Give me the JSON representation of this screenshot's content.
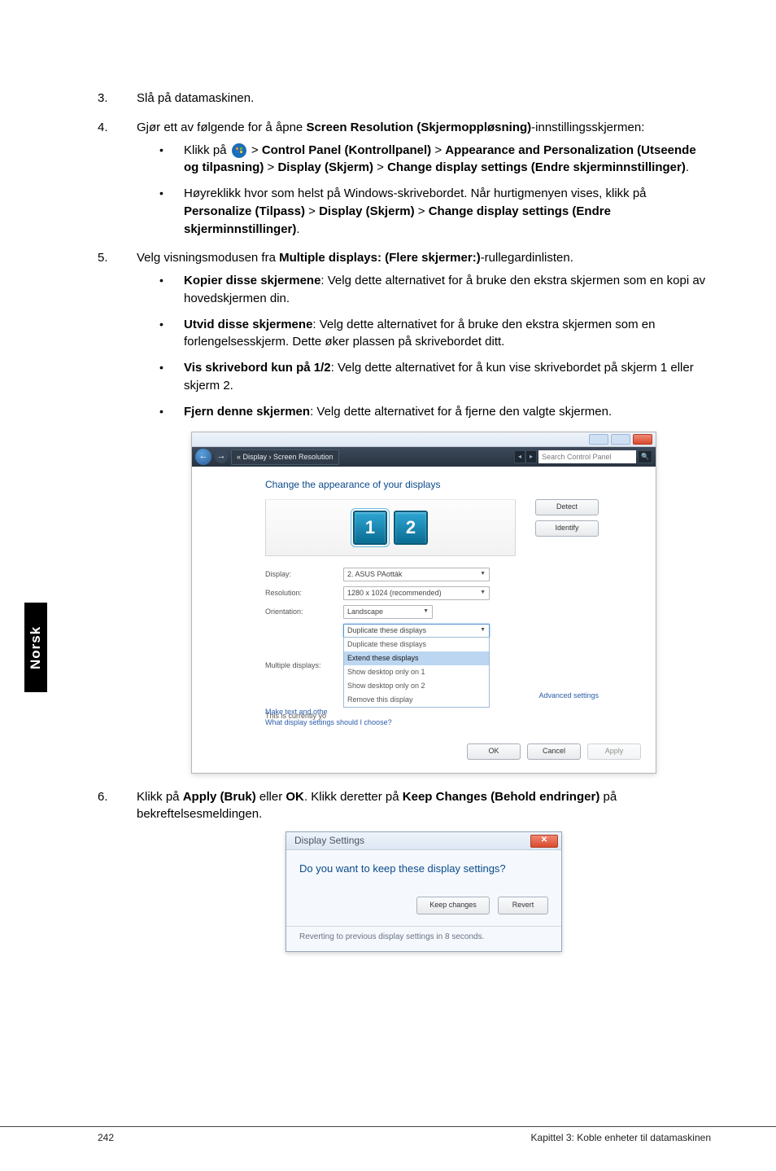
{
  "steps": {
    "s3": "Slå på datamaskinen.",
    "s4_lead": "Gjør ett av følgende for å åpne ",
    "s4_bold": "Screen Resolution (Skjermoppløsning)",
    "s4_tail": "-innstillingsskjermen:",
    "s4a_pre": "Klikk på ",
    "s4a_1": "Control Panel (Kontrollpanel)",
    "s4a_2": "Appearance and Personalization (Utseende og tilpasning)",
    "s4a_3": "Display (Skjerm)",
    "s4a_4": "Change display settings (Endre skjerminnstillinger)",
    "s4b_a": "Høyreklikk hvor som helst på Windows-skrivebordet. Når hurtigmenyen vises, klikk på ",
    "s4b_1": "Personalize (Tilpass)",
    "s4b_2": "Display (Skjerm)",
    "s4b_3": "Change display settings (Endre skjerminnstillinger)",
    "s5_lead": "Velg visningsmodusen fra ",
    "s5_bold": "Multiple displays: (Flere skjermer:)",
    "s5_tail": "-rullegardinlisten.",
    "s5a_b": "Kopier disse skjermene",
    "s5a_t": ": Velg dette alternativet for å bruke den ekstra skjermen som en kopi av hovedskjermen din.",
    "s5b_b": "Utvid disse skjermene",
    "s5b_t": ": Velg dette alternativet for å bruke den ekstra skjermen som en forlengelsesskjerm. Dette øker plassen på skrivebordet ditt.",
    "s5c_b": "Vis skrivebord kun på 1/2",
    "s5c_t": ": Velg dette alternativet for å kun vise skrivebordet på skjerm 1 eller skjerm 2.",
    "s5d_b": "Fjern denne skjermen",
    "s5d_t": ": Velg dette alternativet for å fjerne den valgte skjermen.",
    "s6_a": "Klikk på ",
    "s6_b1": "Apply (Bruk)",
    "s6_m": " eller ",
    "s6_b2": "OK",
    "s6_c": ". Klikk deretter på ",
    "s6_b3": "Keep Changes (Behold endringer)",
    "s6_d": " på bekreftelsesmeldingen."
  },
  "shot1": {
    "breadcrumb": "« Display › Screen Resolution",
    "search_placeholder": "Search Control Panel",
    "heading": "Change the appearance of your displays",
    "detect": "Detect",
    "identify": "Identify",
    "labels": {
      "display": "Display:",
      "resolution": "Resolution:",
      "orientation": "Orientation:",
      "multiple": "Multiple displays:"
    },
    "values": {
      "display": "2. ASUS PAották",
      "resolution": "1280 x 1024 (recommended)",
      "orientation": "Landscape",
      "multiple": "Duplicate these displays"
    },
    "menu": {
      "o1": "Duplicate these displays",
      "o2": "Extend these displays",
      "o3": "Show desktop only on 1",
      "o4": "Show desktop only on 2",
      "o5": "Remove this display"
    },
    "note1": "This is currently yo",
    "note2": "Make text and othe",
    "note3": "What display settings should I choose?",
    "adv": "Advanced settings",
    "ok": "OK",
    "cancel": "Cancel",
    "apply": "Apply"
  },
  "shot2": {
    "title": "Display Settings",
    "question": "Do you want to keep these display settings?",
    "keep": "Keep changes",
    "revert": "Revert",
    "foot": "Reverting to previous display settings in 8 seconds."
  },
  "sidetab": "Norsk",
  "footer": {
    "page": "242",
    "chapter": "Kapittel 3: Koble enheter til datamaskinen"
  }
}
